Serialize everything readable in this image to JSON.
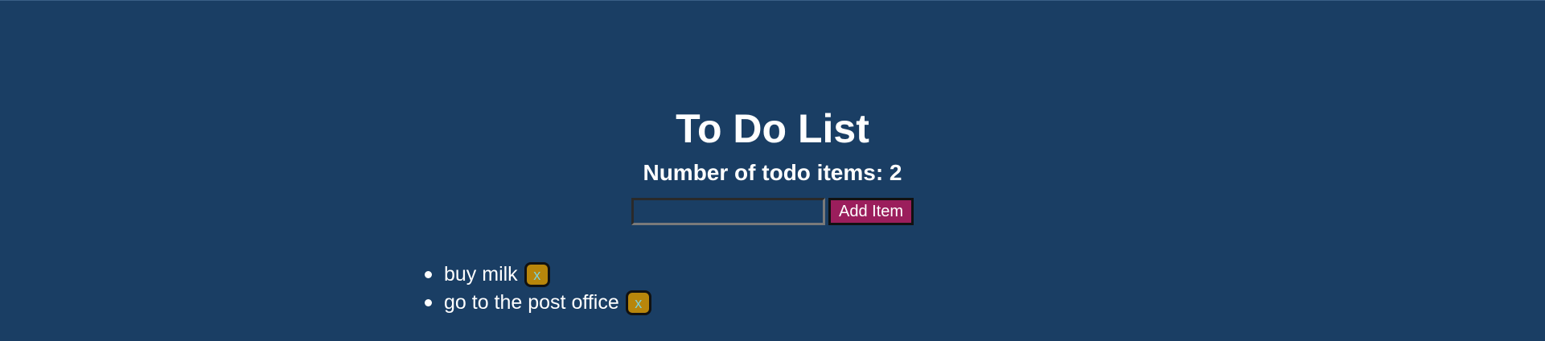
{
  "app": {
    "title": "To Do List",
    "count_label": "Number of todo items: 2"
  },
  "form": {
    "input_value": "",
    "add_label": "Add Item"
  },
  "todos": [
    {
      "text": "buy milk",
      "delete_label": "x"
    },
    {
      "text": "go to the post office",
      "delete_label": "x"
    }
  ],
  "colors": {
    "background": "#1a3e64",
    "add_button": "#9b1e5c",
    "delete_button": "#b8860b",
    "delete_text": "#7ed1d8",
    "text": "#ffffff"
  }
}
